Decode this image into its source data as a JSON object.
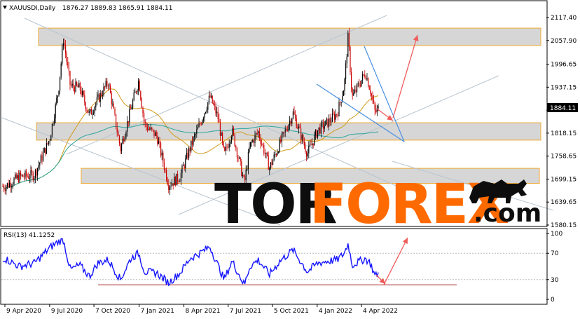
{
  "header": {
    "symbol": "XAUUSDi,Daily",
    "ohlc": "1876.27 1889.83 1865.91 1884.11"
  },
  "rsi_header": "RSI(13) 41.1252",
  "watermark": {
    "part1": "TOR",
    "part2": "FOREX",
    "part3": ".com"
  },
  "colors": {
    "bull": "#000000",
    "bear": "#cc0000",
    "zone_fill": "#d6d6d6",
    "zone_border": "#f0a830",
    "ma_fast": "#d19a1a",
    "ma_slow": "#2aa59a",
    "trend_line": "#b8c4d0",
    "wedge": "#4a90e2",
    "arrow": "#f05a5a",
    "rsi": "#1515ff",
    "rsi_support": "#c06060",
    "brand_orange": "#ff6a00",
    "current_price_bg": "#000000"
  },
  "chart_data": {
    "type": "candlestick",
    "title": "XAUUSDi,Daily",
    "x_ticks": [
      "9 Apr 2020",
      "9 Jul 2020",
      "7 Oct 2020",
      "7 Jan 2021",
      "8 Apr 2021",
      "7 Jul 2021",
      "5 Oct 2021",
      "4 Jan 2022",
      "4 Apr 2022"
    ],
    "y_ticks": [
      2117.4,
      2057.9,
      1996.65,
      1937.15,
      1877.65,
      1818.15,
      1758.65,
      1699.15,
      1639.65,
      1580.15
    ],
    "ylim": [
      1580.15,
      2117.4
    ],
    "current_price": "1884.11",
    "price_path": [
      [
        "2020-04-09",
        1680
      ],
      [
        "2020-05-08",
        1705
      ],
      [
        "2020-06-08",
        1710
      ],
      [
        "2020-07-09",
        1803
      ],
      [
        "2020-07-27",
        1930
      ],
      [
        "2020-08-06",
        2064
      ],
      [
        "2020-08-20",
        1940
      ],
      [
        "2020-09-08",
        1935
      ],
      [
        "2020-09-28",
        1865
      ],
      [
        "2020-10-15",
        1905
      ],
      [
        "2020-11-05",
        1950
      ],
      [
        "2020-11-30",
        1777
      ],
      [
        "2020-12-21",
        1880
      ],
      [
        "2021-01-06",
        1955
      ],
      [
        "2021-01-18",
        1840
      ],
      [
        "2021-02-12",
        1810
      ],
      [
        "2021-03-08",
        1685
      ],
      [
        "2021-03-31",
        1705
      ],
      [
        "2021-04-20",
        1778
      ],
      [
        "2021-05-10",
        1840
      ],
      [
        "2021-05-31",
        1912
      ],
      [
        "2021-06-16",
        1860
      ],
      [
        "2021-06-29",
        1760
      ],
      [
        "2021-07-15",
        1825
      ],
      [
        "2021-08-09",
        1687
      ],
      [
        "2021-08-20",
        1785
      ],
      [
        "2021-09-06",
        1822
      ],
      [
        "2021-09-29",
        1728
      ],
      [
        "2021-10-20",
        1790
      ],
      [
        "2021-11-16",
        1870
      ],
      [
        "2021-12-15",
        1765
      ],
      [
        "2022-01-05",
        1825
      ],
      [
        "2022-01-25",
        1845
      ],
      [
        "2022-02-14",
        1870
      ],
      [
        "2022-02-28",
        1940
      ],
      [
        "2022-03-08",
        2070
      ],
      [
        "2022-03-16",
        1910
      ],
      [
        "2022-04-12",
        1975
      ],
      [
        "2022-04-22",
        1930
      ],
      [
        "2022-05-02",
        1870
      ],
      [
        "2022-05-10",
        1884
      ]
    ],
    "rsi": {
      "label": "RSI(13)",
      "value": "41.1252",
      "levels": [
        100,
        70,
        30,
        0
      ],
      "path": [
        [
          "2020-04-09",
          62
        ],
        [
          "2020-05-08",
          50
        ],
        [
          "2020-06-08",
          55
        ],
        [
          "2020-07-09",
          78
        ],
        [
          "2020-07-27",
          88
        ],
        [
          "2020-08-06",
          90
        ],
        [
          "2020-08-20",
          45
        ],
        [
          "2020-09-08",
          52
        ],
        [
          "2020-09-28",
          35
        ],
        [
          "2020-10-15",
          55
        ],
        [
          "2020-11-05",
          60
        ],
        [
          "2020-11-30",
          30
        ],
        [
          "2020-12-21",
          62
        ],
        [
          "2021-01-06",
          70
        ],
        [
          "2021-01-18",
          42
        ],
        [
          "2021-02-12",
          40
        ],
        [
          "2021-03-08",
          25
        ],
        [
          "2021-03-31",
          40
        ],
        [
          "2021-04-20",
          62
        ],
        [
          "2021-05-10",
          70
        ],
        [
          "2021-05-31",
          80
        ],
        [
          "2021-06-16",
          52
        ],
        [
          "2021-06-29",
          30
        ],
        [
          "2021-07-15",
          58
        ],
        [
          "2021-08-09",
          22
        ],
        [
          "2021-08-20",
          50
        ],
        [
          "2021-09-06",
          60
        ],
        [
          "2021-09-29",
          38
        ],
        [
          "2021-10-20",
          58
        ],
        [
          "2021-11-16",
          75
        ],
        [
          "2021-12-15",
          42
        ],
        [
          "2022-01-05",
          55
        ],
        [
          "2022-01-25",
          58
        ],
        [
          "2022-02-14",
          60
        ],
        [
          "2022-02-28",
          70
        ],
        [
          "2022-03-08",
          85
        ],
        [
          "2022-03-16",
          52
        ],
        [
          "2022-04-12",
          62
        ],
        [
          "2022-04-22",
          55
        ],
        [
          "2022-05-02",
          35
        ],
        [
          "2022-05-10",
          41
        ]
      ]
    },
    "zones": [
      {
        "top": 2090,
        "bottom": 2045
      },
      {
        "top": 1845,
        "bottom": 1800
      },
      {
        "top": 1727,
        "bottom": 1688
      }
    ]
  }
}
